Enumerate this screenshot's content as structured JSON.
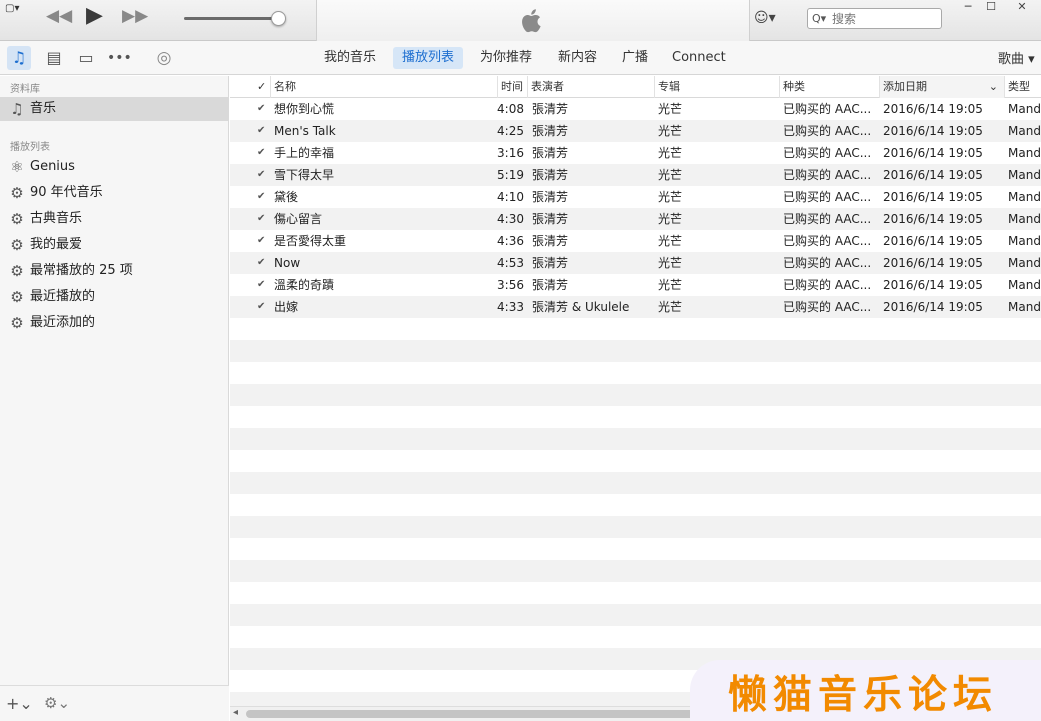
{
  "window": {
    "menu_icon": "▢▾",
    "min": "─",
    "max": "☐",
    "close": "✕"
  },
  "player": {
    "prev": "◀◀",
    "play": "▶",
    "next": "▶▶",
    "volume": 0.9
  },
  "account": {
    "label": "☺▾"
  },
  "search": {
    "placeholder": "搜索",
    "icon": "Q▾"
  },
  "nav": {
    "media_icons": [
      "music-note-icon",
      "film-icon",
      "tv-icon",
      "more-icon",
      "radio-icon"
    ],
    "tabs": [
      "我的音乐",
      "播放列表",
      "为你推荐",
      "新内容",
      "广播",
      "Connect"
    ],
    "active_tab": "播放列表",
    "view": "歌曲 ▾"
  },
  "sidebar": {
    "library_header": "资料库",
    "library_items": [
      {
        "label": "音乐",
        "icon": "music-note-icon"
      }
    ],
    "playlists_header": "播放列表",
    "playlists": [
      {
        "label": "Genius",
        "icon": "genius-atom-icon"
      },
      {
        "label": "90 年代音乐",
        "icon": "smart-playlist-gear-icon"
      },
      {
        "label": "古典音乐",
        "icon": "smart-playlist-gear-icon"
      },
      {
        "label": "我的最爱",
        "icon": "smart-playlist-gear-icon"
      },
      {
        "label": "最常播放的 25 项",
        "icon": "smart-playlist-gear-icon"
      },
      {
        "label": "最近播放的",
        "icon": "smart-playlist-gear-icon"
      },
      {
        "label": "最近添加的",
        "icon": "smart-playlist-gear-icon"
      }
    ],
    "add_button": "+⌄",
    "settings_button": "⚙⌄"
  },
  "table": {
    "columns": {
      "check": "✓",
      "name": "名称",
      "time": "时间",
      "artist": "表演者",
      "album": "专辑",
      "kind": "种类",
      "date_added": "添加日期",
      "date_sort": "⌄",
      "genre": "类型"
    },
    "rows": [
      {
        "name": "想你到心慌",
        "time": "4:08",
        "artist": "張清芳",
        "album": "光芒",
        "kind": "已购买的 AAC...",
        "date_added": "2016/6/14 19:05",
        "genre": "Mandarin"
      },
      {
        "name": "Men's Talk",
        "time": "4:25",
        "artist": "張清芳",
        "album": "光芒",
        "kind": "已购买的 AAC...",
        "date_added": "2016/6/14 19:05",
        "genre": "Mandarin"
      },
      {
        "name": "手上的幸福",
        "time": "3:16",
        "artist": "張清芳",
        "album": "光芒",
        "kind": "已购买的 AAC...",
        "date_added": "2016/6/14 19:05",
        "genre": "Mandarin"
      },
      {
        "name": "雪下得太早",
        "time": "5:19",
        "artist": "張清芳",
        "album": "光芒",
        "kind": "已购买的 AAC...",
        "date_added": "2016/6/14 19:05",
        "genre": "Mandarin"
      },
      {
        "name": "黛後",
        "time": "4:10",
        "artist": "張清芳",
        "album": "光芒",
        "kind": "已购买的 AAC...",
        "date_added": "2016/6/14 19:05",
        "genre": "Mandarin"
      },
      {
        "name": "傷心留言",
        "time": "4:30",
        "artist": "張清芳",
        "album": "光芒",
        "kind": "已购买的 AAC...",
        "date_added": "2016/6/14 19:05",
        "genre": "Mandarin"
      },
      {
        "name": "是否愛得太重",
        "time": "4:36",
        "artist": "張清芳",
        "album": "光芒",
        "kind": "已购买的 AAC...",
        "date_added": "2016/6/14 19:05",
        "genre": "Mandarin"
      },
      {
        "name": "Now",
        "time": "4:53",
        "artist": "張清芳",
        "album": "光芒",
        "kind": "已购买的 AAC...",
        "date_added": "2016/6/14 19:05",
        "genre": "Mandarin"
      },
      {
        "name": "溫柔的奇蹟",
        "time": "3:56",
        "artist": "張清芳",
        "album": "光芒",
        "kind": "已购买的 AAC...",
        "date_added": "2016/6/14 19:05",
        "genre": "Mandarin"
      },
      {
        "name": "出嫁",
        "time": "4:33",
        "artist": "張清芳 & Ukulele",
        "album": "光芒",
        "kind": "已购买的 AAC...",
        "date_added": "2016/6/14 19:05",
        "genre": "Mandarin"
      }
    ]
  },
  "scrollbar": {
    "left": "◂"
  },
  "watermark": {
    "text": "懒猫音乐论坛"
  },
  "colors": {
    "accent": "#1e6fd0",
    "selected_tab": "#d6e6f7",
    "watermark": "#f28a00"
  }
}
